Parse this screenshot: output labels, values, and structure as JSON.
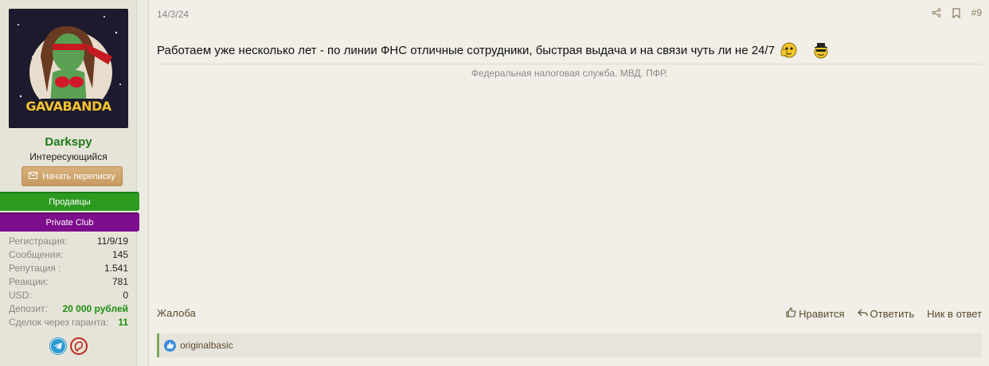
{
  "user": {
    "avatar_text": "GAVABANDA",
    "name": "Darkspy",
    "title": "Интересующийся",
    "message_button": "Начать переписку",
    "banners": [
      "Продавцы",
      "Private Club"
    ],
    "stats": [
      {
        "label": "Регистрация:",
        "value": "11/9/19"
      },
      {
        "label": "Сообщения:",
        "value": "145"
      },
      {
        "label": "Репутация :",
        "value": "1.541"
      },
      {
        "label": "Реакции:",
        "value": "781"
      },
      {
        "label": "USD:",
        "value": "0"
      },
      {
        "label": "Депозит:",
        "value": "20 000 рублей"
      },
      {
        "label": "Сделок через гаранта:",
        "value": "11"
      }
    ],
    "contacts": [
      "telegram-icon",
      "jabber-icon"
    ]
  },
  "post": {
    "date": "14/3/24",
    "number": "#9",
    "text": "Работаем уже несколько лет - по линии ФНС отличные сотрудники, быстрая выдача и на связи чуть ли не 24/7",
    "signature": "Федеральная налоговая служба. МВД. ПФР.",
    "footer": {
      "report": "Жалоба",
      "like": "Нравится",
      "reply": "Ответить",
      "nick": "Ник в ответ"
    },
    "reactions": {
      "users": "originalbasic"
    }
  },
  "colors": {
    "username": "#1d7a17",
    "banner_green": "#2b9a1f",
    "banner_purple": "#7d0d8c",
    "deposit": "#1d8f12"
  }
}
